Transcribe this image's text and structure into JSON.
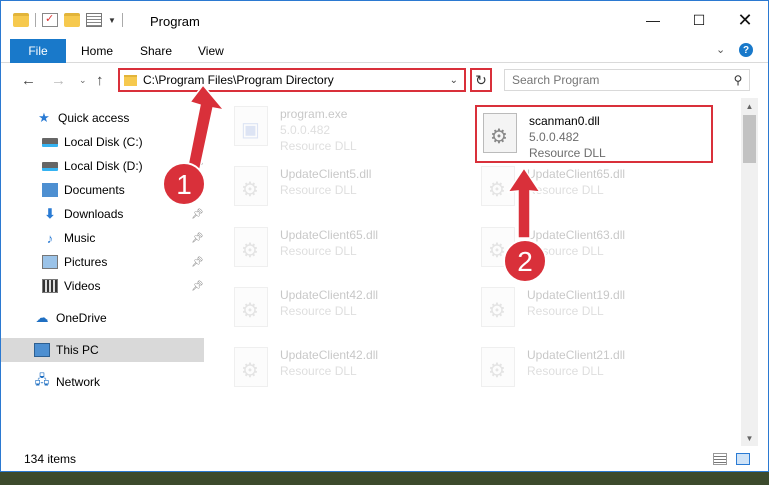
{
  "window": {
    "title": "Program",
    "controls": {
      "minimize": "—",
      "maximize": "☐",
      "close": "✕"
    }
  },
  "ribbon": {
    "file_tab": "File",
    "tabs": [
      "Home",
      "Share",
      "View"
    ],
    "help": "?"
  },
  "navigation": {
    "address_path": "C:\\Program Files\\Program Directory",
    "search_placeholder": "Search Program"
  },
  "sidebar": {
    "items": [
      {
        "label": "Quick access",
        "icon": "star-icon",
        "pinned": false
      },
      {
        "label": "Local Disk (C:)",
        "icon": "disk-icon",
        "pinned": false
      },
      {
        "label": "Local Disk (D:)",
        "icon": "disk-icon",
        "pinned": true
      },
      {
        "label": "Documents",
        "icon": "documents-icon",
        "pinned": true
      },
      {
        "label": "Downloads",
        "icon": "downloads-icon",
        "pinned": true
      },
      {
        "label": "Music",
        "icon": "music-icon",
        "pinned": true
      },
      {
        "label": "Pictures",
        "icon": "pictures-icon",
        "pinned": true
      },
      {
        "label": "Videos",
        "icon": "videos-icon",
        "pinned": true
      },
      {
        "label": "OneDrive",
        "icon": "onedrive-icon",
        "pinned": false
      },
      {
        "label": "This PC",
        "icon": "this-pc-icon",
        "pinned": false,
        "selected": true
      },
      {
        "label": "Network",
        "icon": "network-icon",
        "pinned": false
      }
    ]
  },
  "files": {
    "left": [
      {
        "name": "program.exe",
        "line2": "5.0.0.482",
        "line3": "Resource DLL"
      },
      {
        "name": "UpdateClient5.dll",
        "line2": "Resource DLL"
      },
      {
        "name": "UpdateClient65.dll",
        "line2": "Resource DLL"
      },
      {
        "name": "UpdateClient42.dll",
        "line2": "Resource DLL"
      },
      {
        "name": "UpdateClient42.dll",
        "line2": "Resource DLL"
      }
    ],
    "right": [
      {
        "name": "scanman0.dll",
        "line2": "5.0.0.482",
        "line3": "Resource DLL"
      },
      {
        "name": "UpdateClient65.dll",
        "line2": "Resource DLL"
      },
      {
        "name": "UpdateClient63.dll",
        "line2": "Resource DLL"
      },
      {
        "name": "UpdateClient19.dll",
        "line2": "Resource DLL"
      },
      {
        "name": "UpdateClient21.dll",
        "line2": "Resource DLL"
      }
    ]
  },
  "status": {
    "item_count": "134 items"
  },
  "annotations": {
    "step1": "1",
    "step2": "2",
    "color": "#d9303a"
  },
  "colors": {
    "accent": "#1979ca",
    "highlight": "#d9303a",
    "selected_bg": "#d9d9d9"
  }
}
